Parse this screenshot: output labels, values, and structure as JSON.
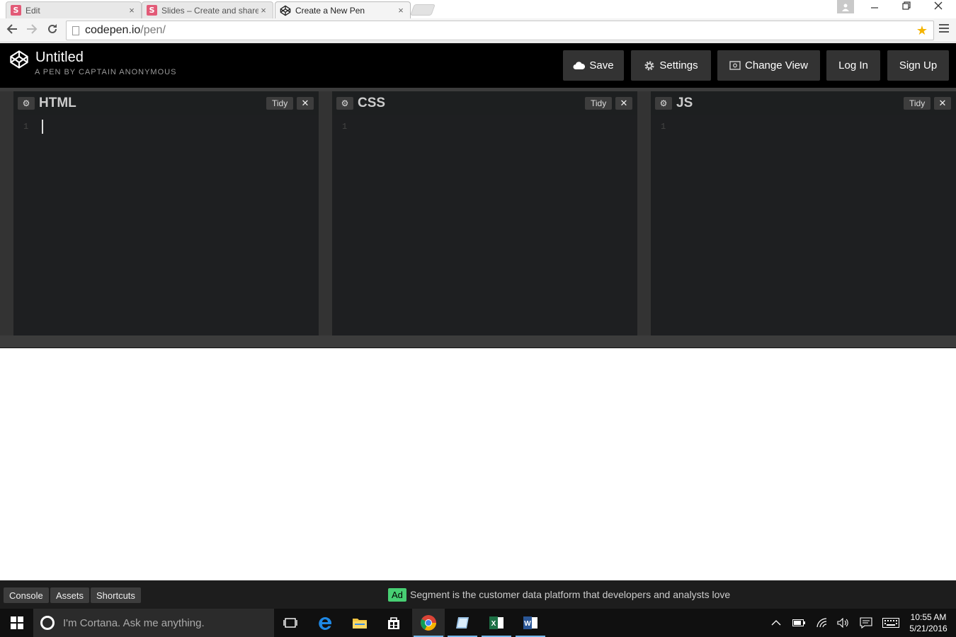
{
  "browser": {
    "tabs": [
      {
        "label": "Edit",
        "icon": "slides-s-icon",
        "active": false
      },
      {
        "label": "Slides – Create and share",
        "icon": "slides-s-icon",
        "active": false
      },
      {
        "label": "Create a New Pen",
        "icon": "codepen-icon",
        "active": true
      }
    ],
    "favicon_letter": "S",
    "tab_close": "×",
    "url_host": "codepen.io",
    "url_path": "/pen/"
  },
  "header": {
    "title": "Untitled",
    "byline": "A PEN BY CAPTAIN ANONYMOUS",
    "buttons": {
      "save": "Save",
      "settings": "Settings",
      "change_view": "Change View",
      "login": "Log In",
      "signup": "Sign Up"
    }
  },
  "editors": [
    {
      "title": "HTML",
      "tidy": "Tidy",
      "line": "1"
    },
    {
      "title": "CSS",
      "tidy": "Tidy",
      "line": "1"
    },
    {
      "title": "JS",
      "tidy": "Tidy",
      "line": "1"
    }
  ],
  "footer": {
    "console": "Console",
    "assets": "Assets",
    "shortcuts": "Shortcuts",
    "ad_badge": "Ad",
    "ad_text": "Segment is the customer data platform that developers and analysts love"
  },
  "taskbar": {
    "cortana_placeholder": "I'm Cortana. Ask me anything.",
    "time": "10:55 AM",
    "date": "5/21/2016"
  },
  "colors": {
    "accent_green": "#47cf73",
    "header_bg": "#000000",
    "editor_bg": "#1e1f21"
  }
}
